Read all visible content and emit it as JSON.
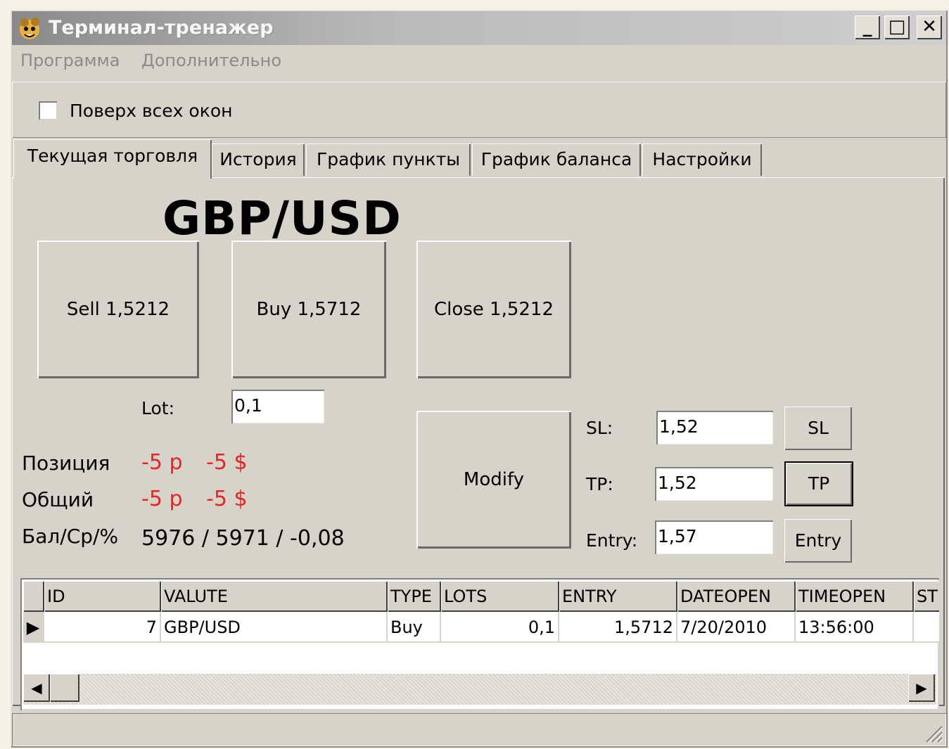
{
  "window": {
    "title": "Терминал-тренажер",
    "minimize": "_",
    "maximize": "□",
    "close": "✕"
  },
  "menu": [
    "Программа",
    "Дополнительно"
  ],
  "top_panel": {
    "ontop_label": "Поверх всех окон",
    "ontop_checked": false
  },
  "tabs": [
    "Текущая торговля",
    "История",
    "График пункты",
    "График баланса",
    "Настройки"
  ],
  "active_tab": "Текущая торговля",
  "trade": {
    "pair": "GBP/USD",
    "sell_label": "Sell 1,5212",
    "buy_label": "Buy 1,5712",
    "close_label": "Close 1,5212",
    "modify_label": "Modify",
    "lot_label": "Lot:",
    "lot_value": "0,1",
    "sl_label": "SL:",
    "sl_value": "1,52",
    "sl_button": "SL",
    "tp_label": "TP:",
    "tp_value": "1,52",
    "tp_button": "TP",
    "entry_label": "Entry:",
    "entry_value": "1,57",
    "entry_button": "Entry"
  },
  "stats": {
    "position_label": "Позиция",
    "position_points": "-5 p",
    "position_money": "-5 $",
    "total_label": "Общий",
    "total_points": "-5 p",
    "total_money": "-5 $",
    "balance_label": "Бал/Ср/%",
    "balance_value": "5976 / 5971 / -0,08"
  },
  "grid": {
    "columns": [
      "ID",
      "VALUTE",
      "TYPE",
      "LOTS",
      "ENTRY",
      "DATEOPEN",
      "TIMEOPEN",
      "ST"
    ],
    "rows": [
      [
        "7",
        "GBP/USD",
        "Buy",
        "0,1",
        "1,5712",
        "7/20/2010",
        "13:56:00",
        ""
      ]
    ],
    "row_indicator": "▶",
    "scroll_left": "◀",
    "scroll_right": "▶"
  },
  "colors": {
    "negative": "#f0211e",
    "face": "#d6d3ca"
  }
}
